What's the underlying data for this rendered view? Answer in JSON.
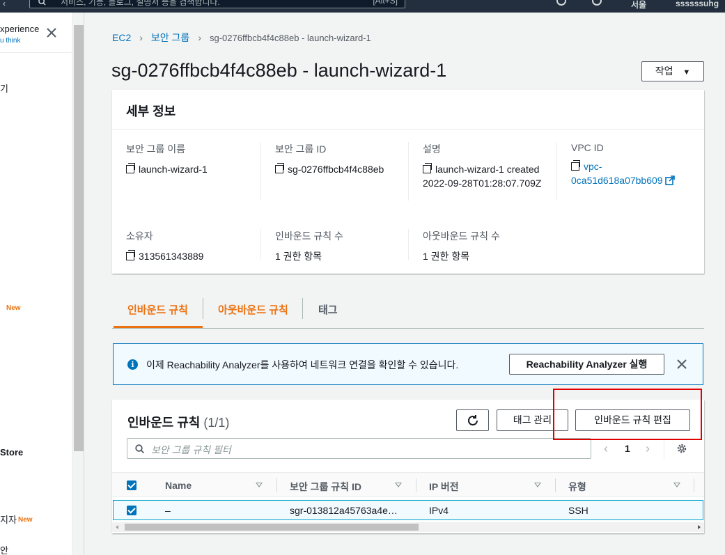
{
  "topbar": {
    "search_placeholder": "서비스, 기능, 블로그, 설명서 등을 검색합니다.",
    "search_shortcut": "[Alt+S]",
    "region_label": "서울",
    "account_label": "ssssssuhg"
  },
  "sidepanel": {
    "experience_title": "xperience",
    "experience_link": "u think",
    "items": [
      {
        "label": "기"
      },
      {
        "label": "",
        "badge": "New"
      },
      {
        "label": "Store"
      },
      {
        "label": "지자",
        "badge": "New"
      },
      {
        "label": "안"
      }
    ]
  },
  "breadcrumb": {
    "items": [
      "EC2",
      "보안 그룹"
    ],
    "current": "sg-0276ffbcb4f4c88eb - launch-wizard-1"
  },
  "page": {
    "title": "sg-0276ffbcb4f4c88eb - launch-wizard-1",
    "actions_label": "작업"
  },
  "details": {
    "heading": "세부 정보",
    "fields": {
      "sg_name": {
        "label": "보안 그룹 이름",
        "value": "launch-wizard-1"
      },
      "sg_id": {
        "label": "보안 그룹 ID",
        "value": "sg-0276ffbcb4f4c88eb"
      },
      "description": {
        "label": "설명",
        "value": "launch-wizard-1 created 2022-09-28T01:28:07.709Z"
      },
      "vpc_id": {
        "label": "VPC ID",
        "value": "vpc-0ca51d618a07bb609"
      },
      "owner": {
        "label": "소유자",
        "value": "313561343889"
      },
      "inbound_count": {
        "label": "인바운드 규칙 수",
        "value": "1 권한 항목"
      },
      "outbound_count": {
        "label": "아웃바운드 규칙 수",
        "value": "1 권한 항목"
      }
    }
  },
  "tabs": [
    {
      "label": "인바운드 규칙",
      "active": true
    },
    {
      "label": "아웃바운드 규칙",
      "active": false
    },
    {
      "label": "태그",
      "active": false
    }
  ],
  "info_banner": {
    "text": "이제 Reachability Analyzer를 사용하여 네트워크 연결을 확인할 수 있습니다.",
    "button_label": "Reachability Analyzer 실행"
  },
  "rules": {
    "heading": "인바운드 규칙",
    "count": "(1/1)",
    "manage_tags_label": "태그 관리",
    "edit_label": "인바운드 규칙 편집",
    "filter_placeholder": "보안 그룹 규칙 필터",
    "page_number": "1",
    "columns": [
      "Name",
      "보안 그룹 규칙 ID",
      "IP 버전",
      "유형"
    ],
    "rows": [
      {
        "name": "–",
        "rule_id": "sgr-013812a45763a4e…",
        "ip_version": "IPv4",
        "type": "SSH"
      }
    ]
  },
  "colors": {
    "accent": "#ec7211",
    "link": "#0073bb",
    "highlight": "#e00000"
  }
}
